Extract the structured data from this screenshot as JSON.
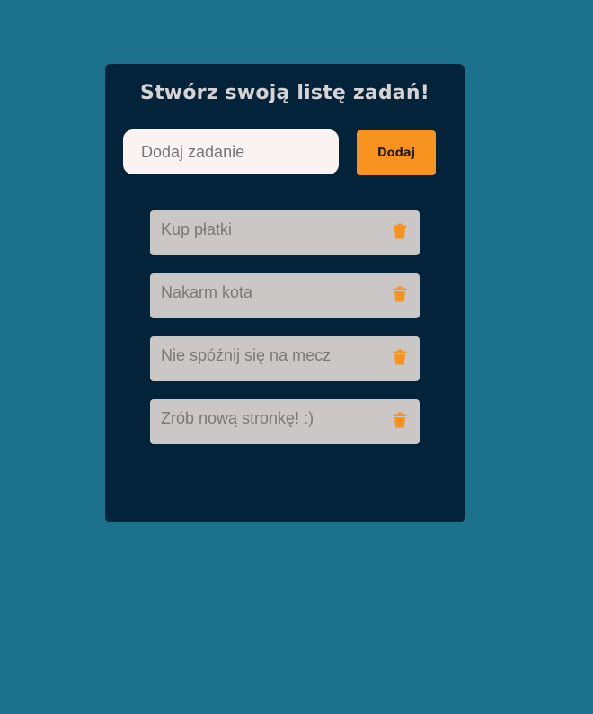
{
  "app": {
    "title": "Stwórz swoją listę zadań!"
  },
  "input": {
    "placeholder": "Dodaj zadanie",
    "value": ""
  },
  "add_button": {
    "label": "Dodaj"
  },
  "tasks": [
    {
      "text": "Kup płatki",
      "icon": "trash-icon"
    },
    {
      "text": "Nakarm kota",
      "icon": "trash-icon"
    },
    {
      "text": "Nie spóźnij się na mecz",
      "icon": "trash-icon"
    },
    {
      "text": "Zrób nową stronkę! :)",
      "icon": "trash-icon"
    }
  ],
  "colors": {
    "background": "#1c728c",
    "card": "#02233a",
    "accent": "#f7931e",
    "task_bg": "#cbc7c6",
    "task_text": "#7d7876",
    "title": "#d6d3d2"
  }
}
